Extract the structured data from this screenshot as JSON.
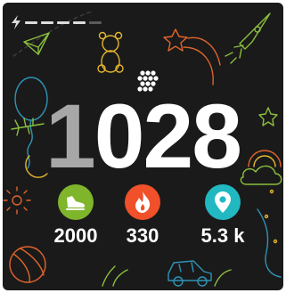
{
  "battery": {
    "segments_total": 5,
    "segments_on": 4,
    "icon": "lightning-bolt-icon"
  },
  "steps": {
    "icon": "footprint-dots-icon",
    "leading_digit": "1",
    "trailing_digits": "028"
  },
  "stats": [
    {
      "icon": "sneaker-icon",
      "color": "#7fb52b",
      "value": "2000"
    },
    {
      "icon": "flame-icon",
      "color": "#f0502a",
      "value": "330"
    },
    {
      "icon": "location-pin-icon",
      "color": "#22b8c2",
      "value": "5.3 k"
    }
  ],
  "colors": {
    "background": "#1a1a1a",
    "doodle_green": "#8bbf3d",
    "doodle_orange": "#e0652c",
    "doodle_blue": "#2f93b6",
    "doodle_yellow": "#e4b52f"
  }
}
